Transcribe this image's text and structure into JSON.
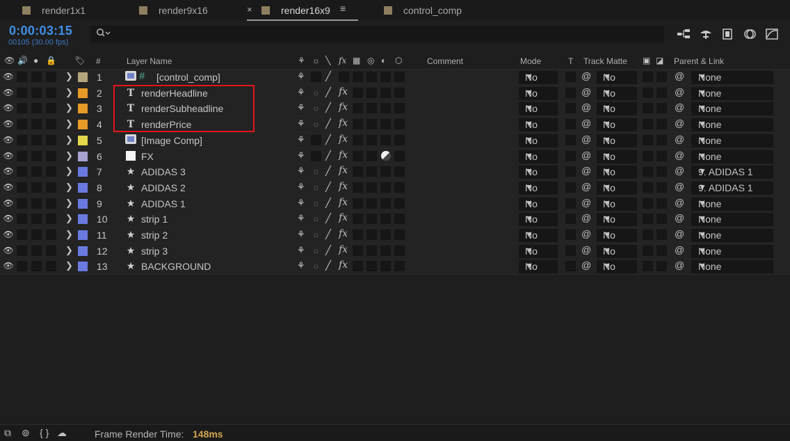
{
  "tabs": [
    {
      "label": "render1x1",
      "active": false
    },
    {
      "label": "render9x16",
      "active": false
    },
    {
      "label": "render16x9",
      "active": true
    },
    {
      "label": "control_comp",
      "active": false
    }
  ],
  "tab_close_glyph": "×",
  "tab_menu_glyph": "≡",
  "timecode": "0:00:03:15",
  "frame_info": "00105 (30.00 fps)",
  "search": {
    "placeholder": "",
    "icon": "search-icon"
  },
  "header": {
    "hash": "#",
    "layer_name": "Layer Name",
    "comment": "Comment",
    "mode": "Mode",
    "t": "T",
    "track_matte": "Track Matte",
    "parent_link": "Parent & Link"
  },
  "layers": [
    {
      "num": "1",
      "name": "[control_comp]",
      "type": "comp-icon",
      "label_color": "#b4a57c",
      "mode": "No",
      "track_matte": "No",
      "parent": "None"
    },
    {
      "num": "2",
      "name": "renderHeadline",
      "type": "text-icon",
      "label_color": "#e69a27",
      "mode": "No",
      "track_matte": "No",
      "parent": "None"
    },
    {
      "num": "3",
      "name": "renderSubheadline",
      "type": "text-icon",
      "label_color": "#e69a27",
      "mode": "No",
      "track_matte": "No",
      "parent": "None"
    },
    {
      "num": "4",
      "name": "renderPrice",
      "type": "text-icon",
      "label_color": "#e69a27",
      "mode": "No",
      "track_matte": "No",
      "parent": "None"
    },
    {
      "num": "5",
      "name": "[Image Comp]",
      "type": "comp-icon",
      "label_color": "#e2d84a",
      "mode": "No",
      "track_matte": "No",
      "parent": "None"
    },
    {
      "num": "6",
      "name": "FX",
      "type": "solid-icon",
      "label_color": "#a6a3cf",
      "mode": "No",
      "track_matte": "No",
      "parent": "None"
    },
    {
      "num": "7",
      "name": "ADIDAS 3",
      "type": "shape-icon",
      "label_color": "#6a7ae0",
      "mode": "No",
      "track_matte": "No",
      "parent": "9. ADIDAS 1"
    },
    {
      "num": "8",
      "name": "ADIDAS 2",
      "type": "shape-icon",
      "label_color": "#6a7ae0",
      "mode": "No",
      "track_matte": "No",
      "parent": "9. ADIDAS 1"
    },
    {
      "num": "9",
      "name": "ADIDAS 1",
      "type": "shape-icon",
      "label_color": "#6a7ae0",
      "mode": "No",
      "track_matte": "No",
      "parent": "None"
    },
    {
      "num": "10",
      "name": "strip 1",
      "type": "shape-icon",
      "label_color": "#6a7ae0",
      "mode": "No",
      "track_matte": "No",
      "parent": "None"
    },
    {
      "num": "11",
      "name": "strip 2",
      "type": "shape-icon",
      "label_color": "#6a7ae0",
      "mode": "No",
      "track_matte": "No",
      "parent": "None"
    },
    {
      "num": "12",
      "name": "strip 3",
      "type": "shape-icon",
      "label_color": "#6a7ae0",
      "mode": "No",
      "track_matte": "No",
      "parent": "None"
    },
    {
      "num": "13",
      "name": "BACKGROUND",
      "type": "shape-icon",
      "label_color": "#6a7ae0",
      "mode": "No",
      "track_matte": "No",
      "parent": "None"
    }
  ],
  "footer": {
    "frame_render_label": "Frame Render Time:",
    "frame_render_value": "148ms"
  },
  "colors": {
    "accent": "#3f8fe8",
    "highlight": "#e3151b",
    "render_time": "#d2a650"
  }
}
